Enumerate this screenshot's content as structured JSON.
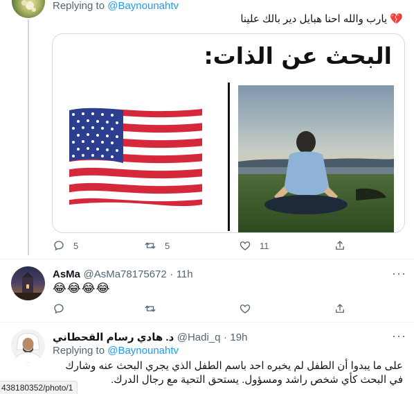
{
  "tweet1": {
    "replying_prefix": "Replying to",
    "replying_handle": "@Baynounahtv",
    "text": "يارب والله احنا هبايل دير بالك علينا",
    "heart_emoji": "💔",
    "image": {
      "title": "البحث عن الذات:"
    },
    "actions": {
      "reply_count": "5",
      "retweet_count": "5",
      "like_count": "11"
    }
  },
  "tweet2": {
    "name": "AsMa",
    "handle": "@AsMa78175672",
    "separator": "·",
    "time": "11h",
    "text": "😂😂😂😂",
    "more": "···"
  },
  "tweet3": {
    "name": "د. هادي رسام القحطاني",
    "handle": "@Hadi_q",
    "separator": "·",
    "time": "19h",
    "replying_prefix": "Replying to",
    "replying_handle": "@Baynounahtv",
    "text_line1": "على ما يبدوا أن الطفل لم يخبره احد باسم الطفل الذي يجري البحث عنه وشارك",
    "text_line2": "في البحث كأي شخص راشد ومسؤول. يستحق التحية مع رجال الدرك.",
    "more": "···"
  },
  "status_bar": {
    "url": "438180352/photo/1"
  },
  "colors": {
    "accent": "#1d9bf0",
    "muted": "#536471",
    "border": "#cfd9de"
  }
}
